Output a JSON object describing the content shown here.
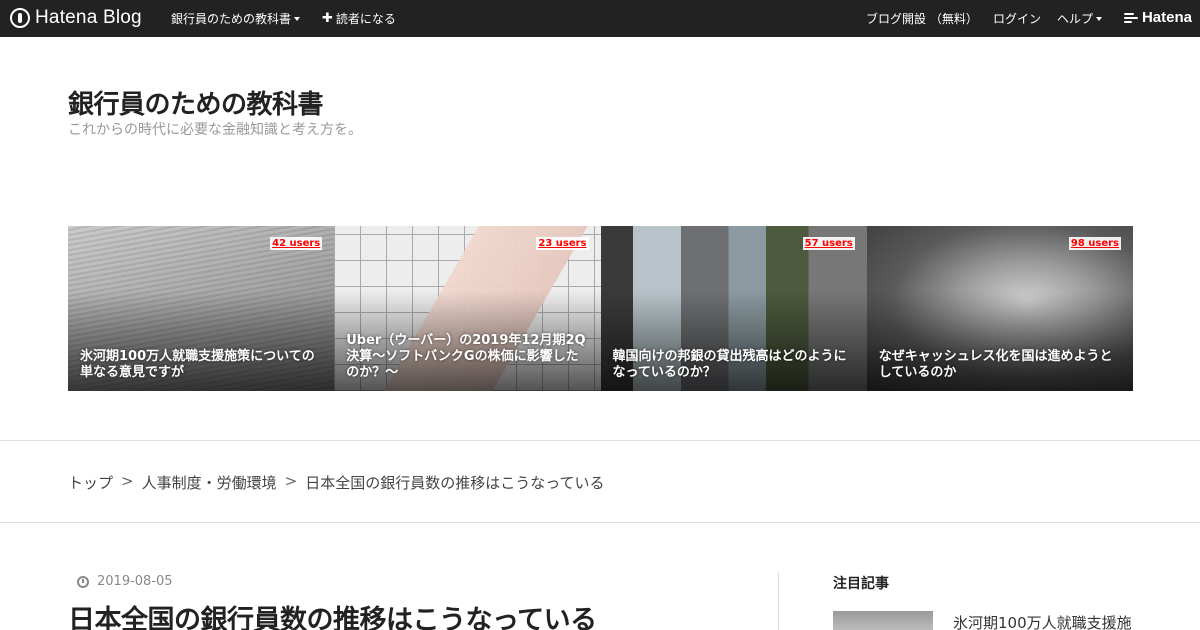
{
  "topbar": {
    "logo_text": "Hatena Blog",
    "blog_menu_label": "銀行員のための教科書",
    "subscribe_label": "読者になる",
    "start_blog_label": "ブログ開設 （無料）",
    "login_label": "ログイン",
    "help_label": "ヘルプ",
    "brand_label": "Hatena"
  },
  "blog": {
    "title": "銀行員のための教科書",
    "description": "これからの時代に必要な金融知識と考え方を。"
  },
  "featured": [
    {
      "users": "42 users",
      "title": "氷河期100万人就職支援施策についての単なる意見ですが"
    },
    {
      "users": "23 users",
      "title": "Uber（ウーバー）の2019年12月期2Q決算～ソフトバンクGの株価に影響したのか？～"
    },
    {
      "users": "57 users",
      "title": "韓国向けの邦銀の貸出残高はどのようになっているのか？"
    },
    {
      "users": "98 users",
      "title": "なぜキャッシュレス化を国は進めようとしているのか"
    }
  ],
  "breadcrumb": {
    "items": [
      "トップ",
      "人事制度・労働環境",
      "日本全国の銀行員数の推移はこうなっている"
    ],
    "separator": ">"
  },
  "article": {
    "date": "2019-08-05",
    "title": "日本全国の銀行員数の推移はこうなっている"
  },
  "sidebar": {
    "heading": "注目記事",
    "items": [
      {
        "title": "氷河期100万人就職支援施"
      }
    ]
  },
  "colors": {
    "topbar": "#222222",
    "users_badge": "#ff0000"
  }
}
